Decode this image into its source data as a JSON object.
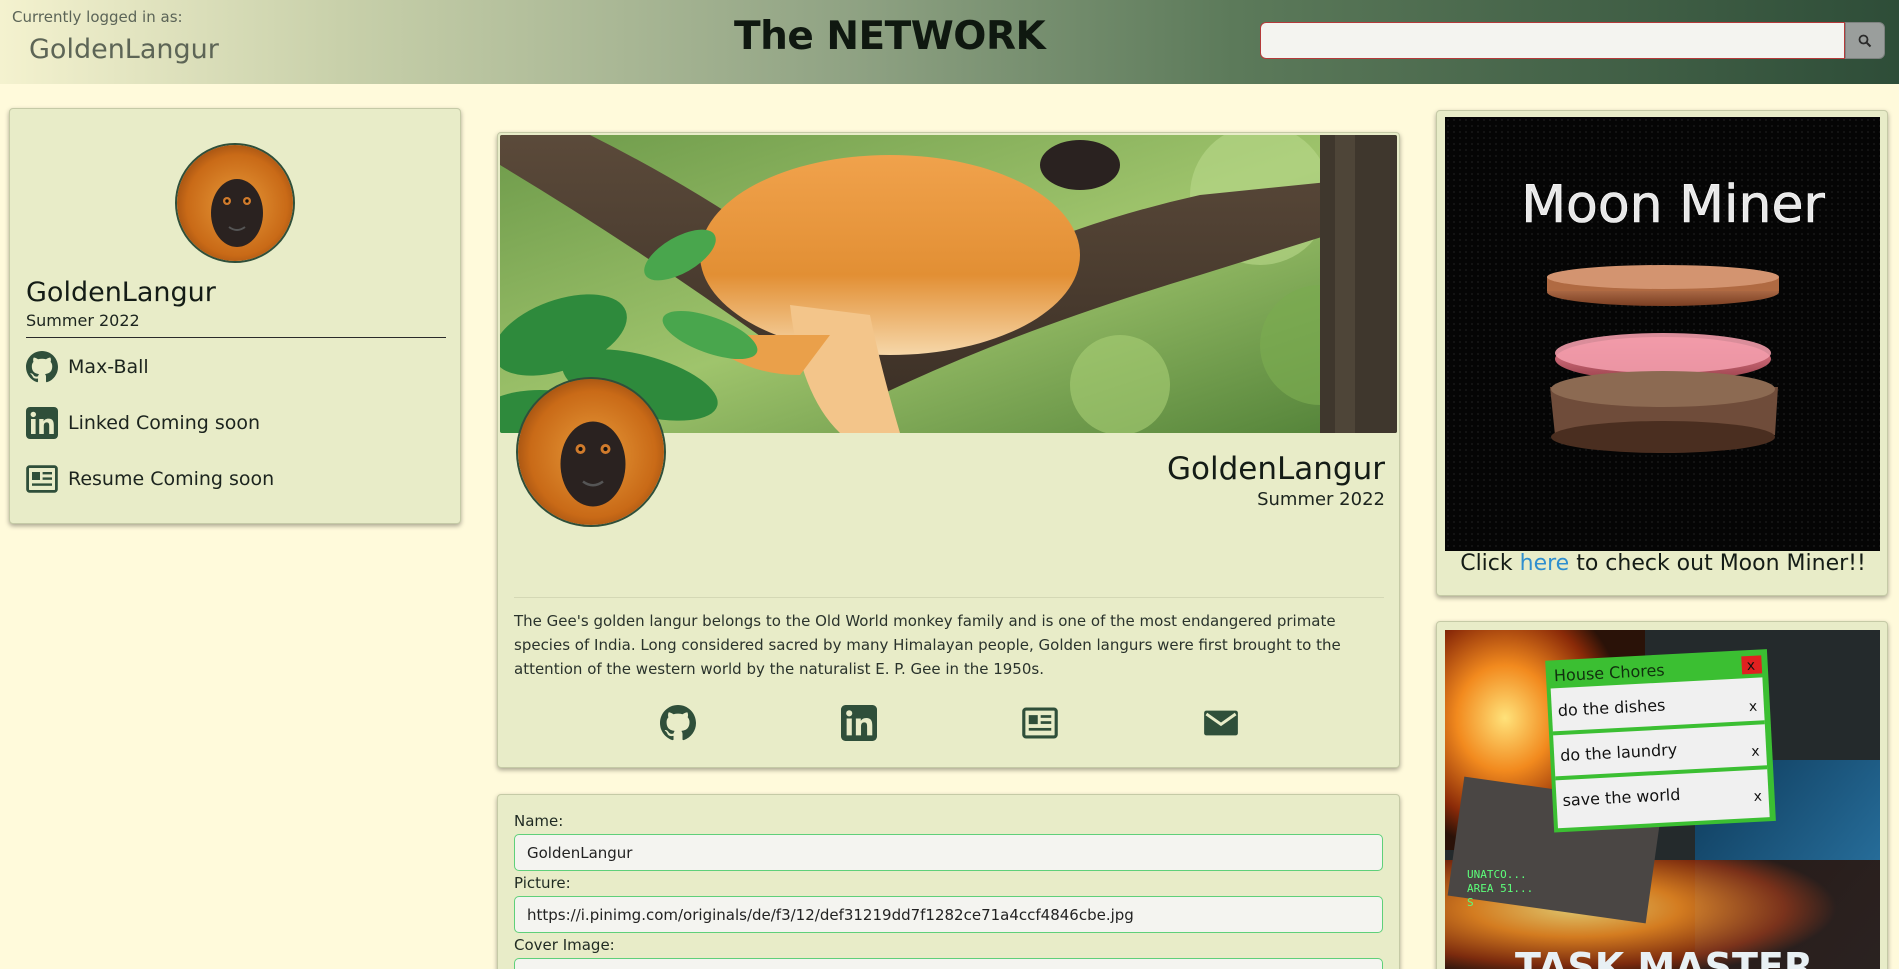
{
  "header": {
    "logged_caption": "Currently logged in as:",
    "logged_user": "GoldenLangur",
    "title": "The NETWORK",
    "search_value": "",
    "search_icon": "search-icon"
  },
  "sidebar": {
    "name": "GoldenLangur",
    "term": "Summer 2022",
    "links": [
      {
        "icon": "github-icon",
        "label": "Max-Ball"
      },
      {
        "icon": "linkedin-icon",
        "label": "Linked Coming soon"
      },
      {
        "icon": "resume-icon",
        "label": "Resume Coming soon"
      }
    ]
  },
  "profile": {
    "name": "GoldenLangur",
    "term": "Summer 2022",
    "bio": "The Gee's golden langur belongs to the Old World monkey family and is one of the most endangered primate species of India. Long considered sacred by many Himalayan people, Golden langurs were first brought to the attention of the western world by the naturalist E. P. Gee in the 1950s.",
    "social_icons": [
      "github-icon",
      "linkedin-icon",
      "resume-icon",
      "email-icon"
    ]
  },
  "form": {
    "name_label": "Name:",
    "name_value": "GoldenLangur",
    "picture_label": "Picture:",
    "picture_value": "https://i.pinimg.com/originals/de/f3/12/def31219dd7f1282ce71a4ccf4846cbe.jpg",
    "cover_label": "Cover Image:"
  },
  "ads": {
    "moon_title": "Moon Miner",
    "moon_caption_pre": "Click ",
    "moon_caption_link": "here",
    "moon_caption_post": " to check out Moon Miner!!",
    "task": {
      "window_title": "House Chores",
      "close": "x",
      "items": [
        {
          "label": "do the dishes",
          "remove": "x"
        },
        {
          "label": "do the laundry",
          "remove": "x"
        },
        {
          "label": "save the world",
          "remove": "x"
        }
      ],
      "screen_text_1": "UNATCO...",
      "screen_text_2": "AREA 51...",
      "screen_text_3": "S",
      "banner": "TASK MASTER"
    }
  },
  "colors": {
    "background": "#fffadb",
    "card": "#e8ecc8",
    "accent_dark": "#2f4f3a",
    "link": "#2f8fcf",
    "input_border": "#5fd07a"
  }
}
